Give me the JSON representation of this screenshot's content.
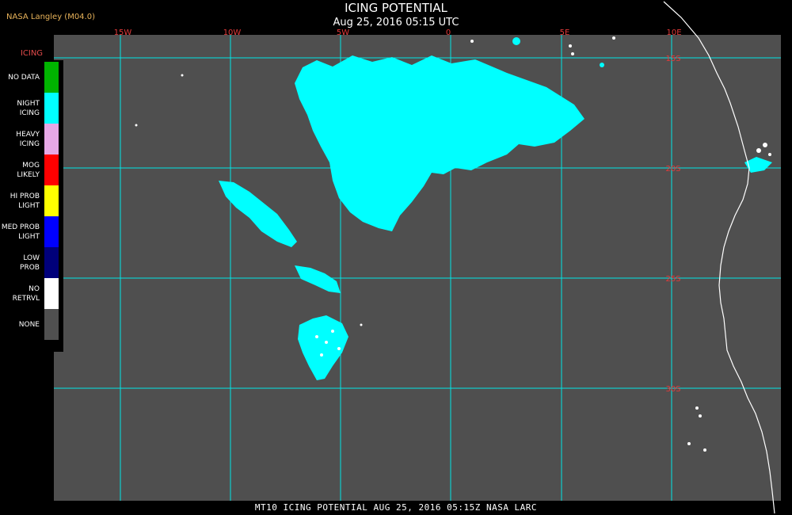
{
  "title": "ICING POTENTIAL",
  "subtitle": "Aug 25, 2016 05:15 UTC",
  "credit": "NASA Langley (M04.0)",
  "bottom_caption": "MT10   ICING POTENTIAL   AUG 25, 2016 05:15Z   NASA LARC",
  "legend": {
    "title": "ICING",
    "items": [
      {
        "label": "NO DATA",
        "color": "#00b400"
      },
      {
        "label": "NIGHT\nICING",
        "color": "#00ffff"
      },
      {
        "label": "HEAVY\nICING",
        "color": "#e6a8e6"
      },
      {
        "label": "MOG\nLIKELY",
        "color": "#ff0000"
      },
      {
        "label": "HI PROB\nLIGHT",
        "color": "#ffff00"
      },
      {
        "label": "MED PROB\nLIGHT",
        "color": "#0000ff"
      },
      {
        "label": "LOW\nPROB",
        "color": "#00007a"
      },
      {
        "label": "NO\nRETRVL",
        "color": "#ffffff"
      },
      {
        "label": "NONE",
        "color": "#505050"
      }
    ]
  },
  "map": {
    "background_color": "#4f4f4f",
    "grid_color": "#00e5e5",
    "label_color": "#e53a3a",
    "longitude_labels": [
      "15W",
      "10W",
      "5W",
      "0",
      "5E",
      "10E"
    ],
    "latitude_labels": [
      "15S",
      "20S",
      "25S",
      "30S"
    ]
  }
}
